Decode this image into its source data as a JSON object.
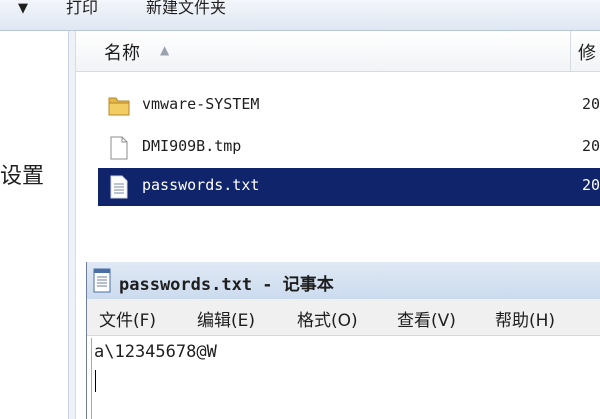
{
  "commandbar": {
    "arrow_glyph": "▼",
    "print_label": "打印",
    "new_folder_label": "新建文件夹"
  },
  "navpane": {
    "partial_label": "设置"
  },
  "filelist": {
    "header": {
      "name_label": "名称",
      "sort_glyph": "▲",
      "date_label": "修"
    },
    "files": [
      {
        "name": "vmware-SYSTEM",
        "date": "20",
        "icon": "folder-icon",
        "selected": false
      },
      {
        "name": "DMI909B.tmp",
        "date": "20",
        "icon": "file-icon",
        "selected": false
      },
      {
        "name": "passwords.txt",
        "date": "20",
        "icon": "text-file-icon",
        "selected": true
      }
    ]
  },
  "notepad": {
    "title": "passwords.txt - 记事本",
    "menus": [
      {
        "label": "文件(F)"
      },
      {
        "label": "编辑(E)"
      },
      {
        "label": "格式(O)"
      },
      {
        "label": "查看(V)"
      },
      {
        "label": "帮助(H)"
      }
    ],
    "content": "a\\12345678@W"
  },
  "colors": {
    "selection": "#0f246b",
    "folder": "#e3b84a"
  }
}
